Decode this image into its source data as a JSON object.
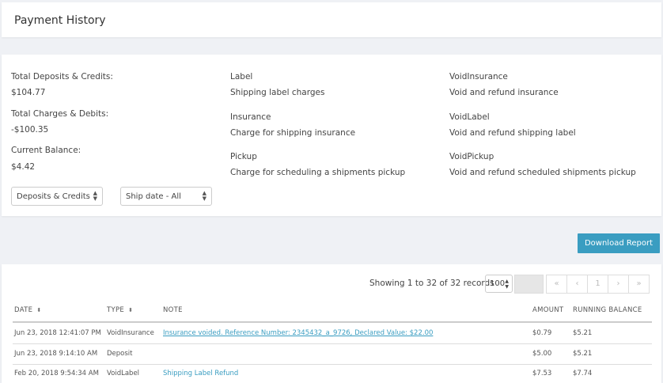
{
  "header": {
    "title": "Payment History"
  },
  "summary": {
    "totals": [
      {
        "label": "Total Deposits & Credits:",
        "value": "$104.77"
      },
      {
        "label": "Total Charges & Debits:",
        "value": "-$100.35"
      },
      {
        "label": "Current Balance:",
        "value": "$4.42"
      }
    ],
    "legend_col1": [
      {
        "title": "Label",
        "desc": "Shipping label charges"
      },
      {
        "title": "Insurance",
        "desc": "Charge for shipping insurance"
      },
      {
        "title": "Pickup",
        "desc": "Charge for scheduling a shipments pickup"
      }
    ],
    "legend_col2": [
      {
        "title": "VoidInsurance",
        "desc": "Void and refund insurance"
      },
      {
        "title": "VoidLabel",
        "desc": "Void and refund shipping label"
      },
      {
        "title": "VoidPickup",
        "desc": "Void and refund scheduled shipments pickup"
      }
    ],
    "filters": {
      "type_selected": "Deposits & Credits",
      "date_selected": "Ship date - All"
    }
  },
  "actions": {
    "download_label": "Download Report"
  },
  "table": {
    "records_info": "Showing 1 to 32 of 32 records",
    "page_size": "100",
    "pager": {
      "first": "«",
      "prev": "‹",
      "current": "1",
      "next": "›",
      "last": "»"
    },
    "columns": {
      "date": "DATE",
      "type": "TYPE",
      "note": "NOTE",
      "amount": "AMOUNT",
      "balance": "RUNNING BALANCE"
    },
    "rows": [
      {
        "date": "Jun 23, 2018 12:41:07 PM",
        "type": "VoidInsurance",
        "note": "Insurance voided. Reference Number: 2345432_a_9726, Declared Value: $22.00",
        "amount": "$0.79",
        "balance": "$5.21"
      },
      {
        "date": "Jun 23, 2018 9:14:10 AM",
        "type": "Deposit",
        "note": "",
        "amount": "$5.00",
        "balance": "$5.21"
      },
      {
        "date": "Feb 20, 2018 9:54:34 AM",
        "type": "VoidLabel",
        "note": "Shipping Label Refund",
        "amount": "$7.53",
        "balance": "$7.74"
      }
    ]
  },
  "colors": {
    "accent": "#3a9dc1",
    "background": "#eff1f5"
  },
  "icons": {
    "sort": "sort-updown-icon",
    "select": "select-arrows-icon"
  }
}
